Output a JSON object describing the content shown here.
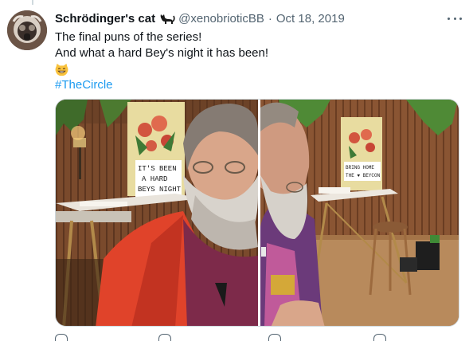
{
  "tweet": {
    "display_name": "Schrödinger's cat",
    "display_name_emoji": "black-cat-emoji",
    "handle": "@xenobrioticBB",
    "separator": "·",
    "date": "Oct 18, 2019",
    "text_lines": [
      "The final puns of the series!",
      "And what a hard Bey's night it has been!"
    ],
    "emoji": "grinning-cat-emoji",
    "hashtag": "#TheCircle"
  },
  "media": {
    "left_poster_text": [
      "IT'S BEEN",
      "A HARD",
      "BEYS NIGHT"
    ],
    "right_poster_text": [
      "BRING HOME",
      "THE ♥ BEYCON"
    ]
  },
  "colors": {
    "accent": "#1d9bf0",
    "secondary_text": "#536471",
    "primary_text": "#0f1419"
  }
}
